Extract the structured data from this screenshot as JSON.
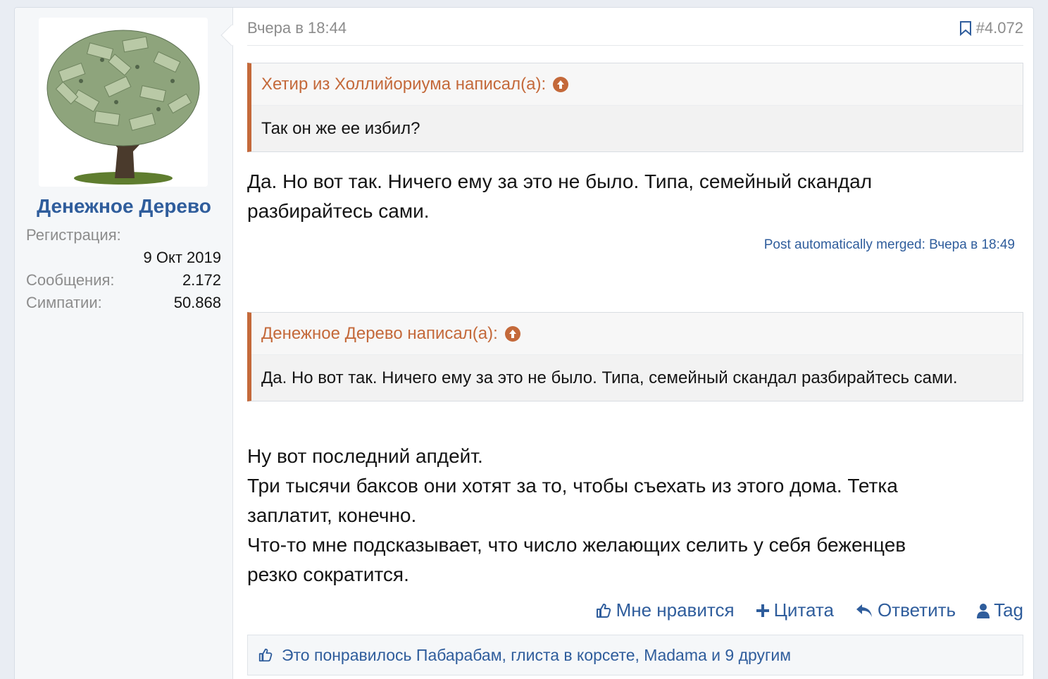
{
  "user": {
    "name": "Денежное Дерево",
    "stats": [
      {
        "label": "Регистрация:",
        "value": "9 Окт 2019"
      },
      {
        "label": "Сообщения:",
        "value": "2.172"
      },
      {
        "label": "Симпатии:",
        "value": "50.868"
      }
    ]
  },
  "post": {
    "date": "Вчера в 18:44",
    "number": "#4.072",
    "quote1": {
      "author": "Хетир из Холлийориума написал(а):",
      "text": "Так он же ее избил?"
    },
    "reply1": {
      "line1": "Да. Но вот так. Ничего ему за это не было. Типа, семейный скандал",
      "line2": "разбирайтесь сами."
    },
    "merged": "Post automatically merged: Вчера в 18:49",
    "quote2": {
      "author": "Денежное Дерево написал(а):",
      "text": "Да. Но вот так. Ничего ему за это не было. Типа, семейный скандал разбирайтесь сами."
    },
    "reply2": {
      "line1": "Ну вот последний апдейт.",
      "line2": "Три тысячи баксов они хотят за то, чтобы съехать из этого дома. Тетка",
      "line3": "заплатит, конечно.",
      "line4": "Что-то мне подсказывает, что число желающих селить у себя беженцев",
      "line5": "резко сократится."
    }
  },
  "actions": {
    "like": "Мне нравится",
    "quote": "Цитата",
    "reply": "Ответить",
    "tag": "Tag"
  },
  "likes_text": "Это понравилось Пабарабам, глиста в корсете, Madama и 9 другим",
  "colors": {
    "link": "#2f5d9c",
    "quote_accent": "#c4693a",
    "muted": "#8c8c8c"
  }
}
